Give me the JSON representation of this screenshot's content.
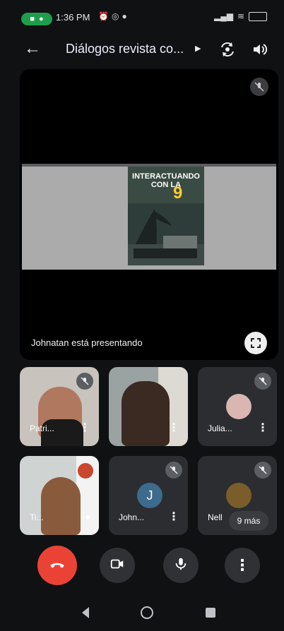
{
  "status_bar": {
    "time": "1:36 PM",
    "pill_icons": [
      "camera-icon",
      "mic-icon"
    ],
    "icons": [
      "alarm-icon",
      "whatsapp-icon",
      "messenger-icon"
    ],
    "right_icons": [
      "signal-icon",
      "wifi-icon",
      "battery-icon"
    ],
    "accent": "#1e9e4a"
  },
  "app_bar": {
    "title": "Diálogos revista co...",
    "back_icon": "back-arrow-icon",
    "title_icon": "chevron-right-icon",
    "flip_icon": "flip-camera-icon",
    "audio_icon": "speaker-icon"
  },
  "presentation": {
    "poster_title": "INTERACTUANDO CON LA",
    "poster_number": "9",
    "presenter_label": "Johnatan está presentando",
    "fullscreen_icon": "fullscreen-icon",
    "muted_icon": "mic-off-icon"
  },
  "participants": [
    {
      "name": "Patri...",
      "muted": true,
      "video": true
    },
    {
      "name": "",
      "muted": false,
      "video": true
    },
    {
      "name": "Julia...",
      "muted": true,
      "video": false,
      "avatar": "photo"
    },
    {
      "name": "Ti...",
      "muted": false,
      "video": true,
      "speaking": true
    },
    {
      "name": "John...",
      "muted": true,
      "video": false,
      "avatar_letter": "J",
      "avatar_color": "#3d6b8d"
    },
    {
      "name": "Nell",
      "muted": true,
      "video": false,
      "avatar": "photo"
    }
  ],
  "more_badge": "9 más",
  "controls": {
    "end_call_color": "#ea4335",
    "end_call_icon": "hang-up-icon",
    "video_icon": "video-camera-icon",
    "mic_icon": "mic-icon",
    "more_icon": "more-vertical-icon"
  },
  "nav": {
    "back": "nav-back-icon",
    "home": "nav-home-icon",
    "recent": "nav-recent-icon"
  }
}
